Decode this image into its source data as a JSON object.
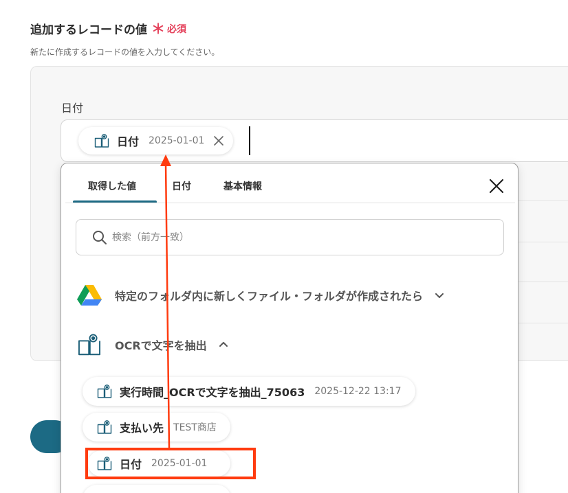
{
  "section": {
    "title": "追加するレコードの値",
    "required_mark": "＊",
    "required_text": "必須",
    "description": "新たに作成するレコードの値を入力してください。"
  },
  "field": {
    "label": "日付",
    "chip": {
      "label": "日付",
      "value": "2025-01-01"
    }
  },
  "popup": {
    "tabs": [
      {
        "label": "取得した値",
        "active": true
      },
      {
        "label": "日付",
        "active": false
      },
      {
        "label": "基本情報",
        "active": false
      }
    ],
    "search": {
      "placeholder": "検索（前方一致）",
      "value": ""
    },
    "groups": [
      {
        "label": "特定のフォルダ内に新しくファイル・フォルダが作成されたら",
        "icon": "google-drive-icon",
        "expanded": false
      },
      {
        "label": "OCRで文字を抽出",
        "icon": "ocr-book-icon",
        "expanded": true
      }
    ],
    "items": [
      {
        "label": "実行時間_OCRで文字を抽出_75063",
        "value": "2025-12-22 13:17"
      },
      {
        "label": "支払い先",
        "value": "TEST商店"
      },
      {
        "label": "日付",
        "value": "2025-01-01"
      }
    ]
  },
  "colors": {
    "accent": "#1c6a84",
    "required": "#e4405a",
    "annotation": "#ff3b0f"
  }
}
